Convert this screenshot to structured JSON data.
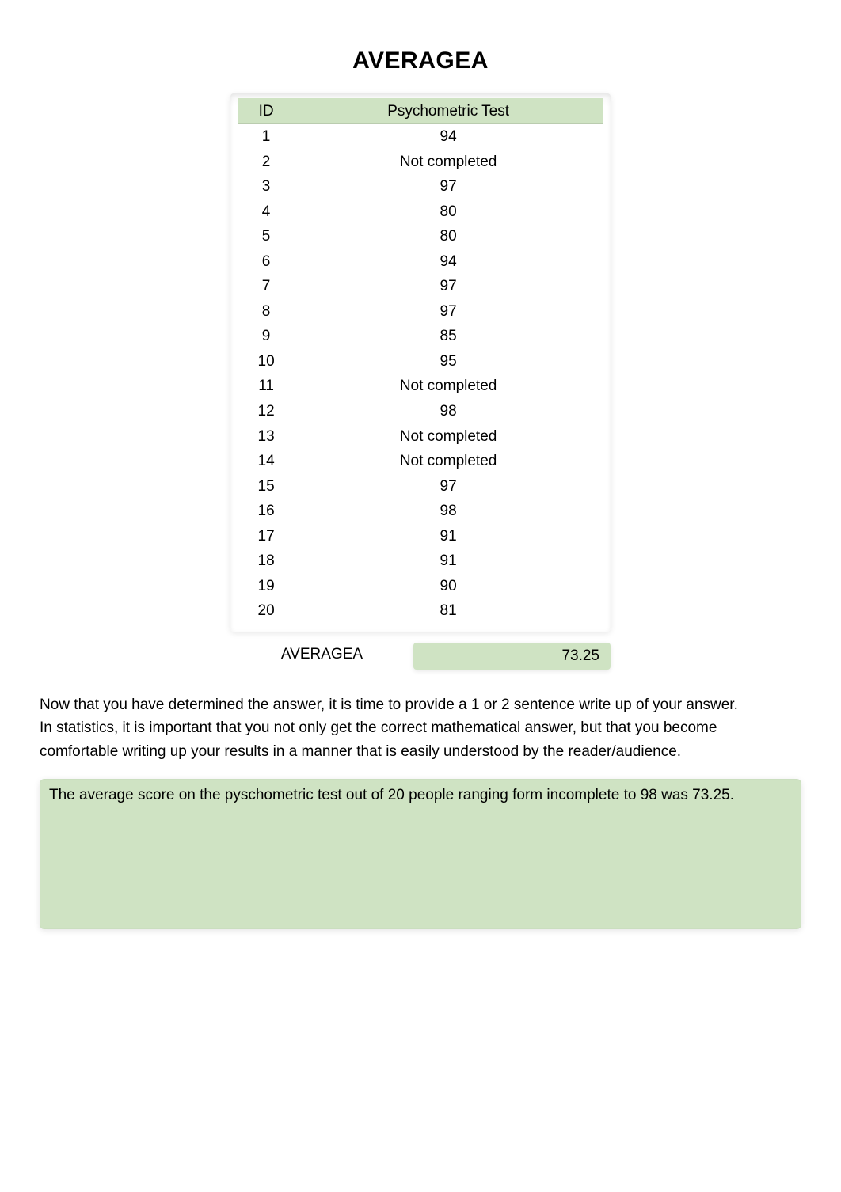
{
  "title": "AVERAGEA",
  "table": {
    "headers": {
      "id": "ID",
      "score": "Psychometric Test"
    },
    "rows": [
      {
        "id": "1",
        "score": "94"
      },
      {
        "id": "2",
        "score": "Not completed"
      },
      {
        "id": "3",
        "score": "97"
      },
      {
        "id": "4",
        "score": "80"
      },
      {
        "id": "5",
        "score": "80"
      },
      {
        "id": "6",
        "score": "94"
      },
      {
        "id": "7",
        "score": "97"
      },
      {
        "id": "8",
        "score": "97"
      },
      {
        "id": "9",
        "score": "85"
      },
      {
        "id": "10",
        "score": "95"
      },
      {
        "id": "11",
        "score": "Not completed"
      },
      {
        "id": "12",
        "score": "98"
      },
      {
        "id": "13",
        "score": "Not completed"
      },
      {
        "id": "14",
        "score": "Not completed"
      },
      {
        "id": "15",
        "score": "97"
      },
      {
        "id": "16",
        "score": "98"
      },
      {
        "id": "17",
        "score": "91"
      },
      {
        "id": "18",
        "score": "91"
      },
      {
        "id": "19",
        "score": "90"
      },
      {
        "id": "20",
        "score": "81"
      }
    ]
  },
  "summary": {
    "label": "AVERAGEA",
    "value": "73.25"
  },
  "instructions": "Now that you have determined the answer, it is time to provide a 1 or 2 sentence write up of your answer. In statistics, it is important that you not only get the correct mathematical answer, but that you become comfortable writing up your results in a manner that is easily understood by the reader/audience.",
  "answer": "The average score on the pyschometric test out of 20 people ranging form incomplete to 98 was 73.25.",
  "chart_data": {
    "type": "table",
    "title": "AVERAGEA",
    "columns": [
      "ID",
      "Psychometric Test"
    ],
    "rows": [
      [
        1,
        94
      ],
      [
        2,
        "Not completed"
      ],
      [
        3,
        97
      ],
      [
        4,
        80
      ],
      [
        5,
        80
      ],
      [
        6,
        94
      ],
      [
        7,
        97
      ],
      [
        8,
        97
      ],
      [
        9,
        85
      ],
      [
        10,
        95
      ],
      [
        11,
        "Not completed"
      ],
      [
        12,
        98
      ],
      [
        13,
        "Not completed"
      ],
      [
        14,
        "Not completed"
      ],
      [
        15,
        97
      ],
      [
        16,
        98
      ],
      [
        17,
        91
      ],
      [
        18,
        91
      ],
      [
        19,
        90
      ],
      [
        20,
        81
      ]
    ],
    "summary": {
      "AVERAGEA": 73.25
    }
  }
}
